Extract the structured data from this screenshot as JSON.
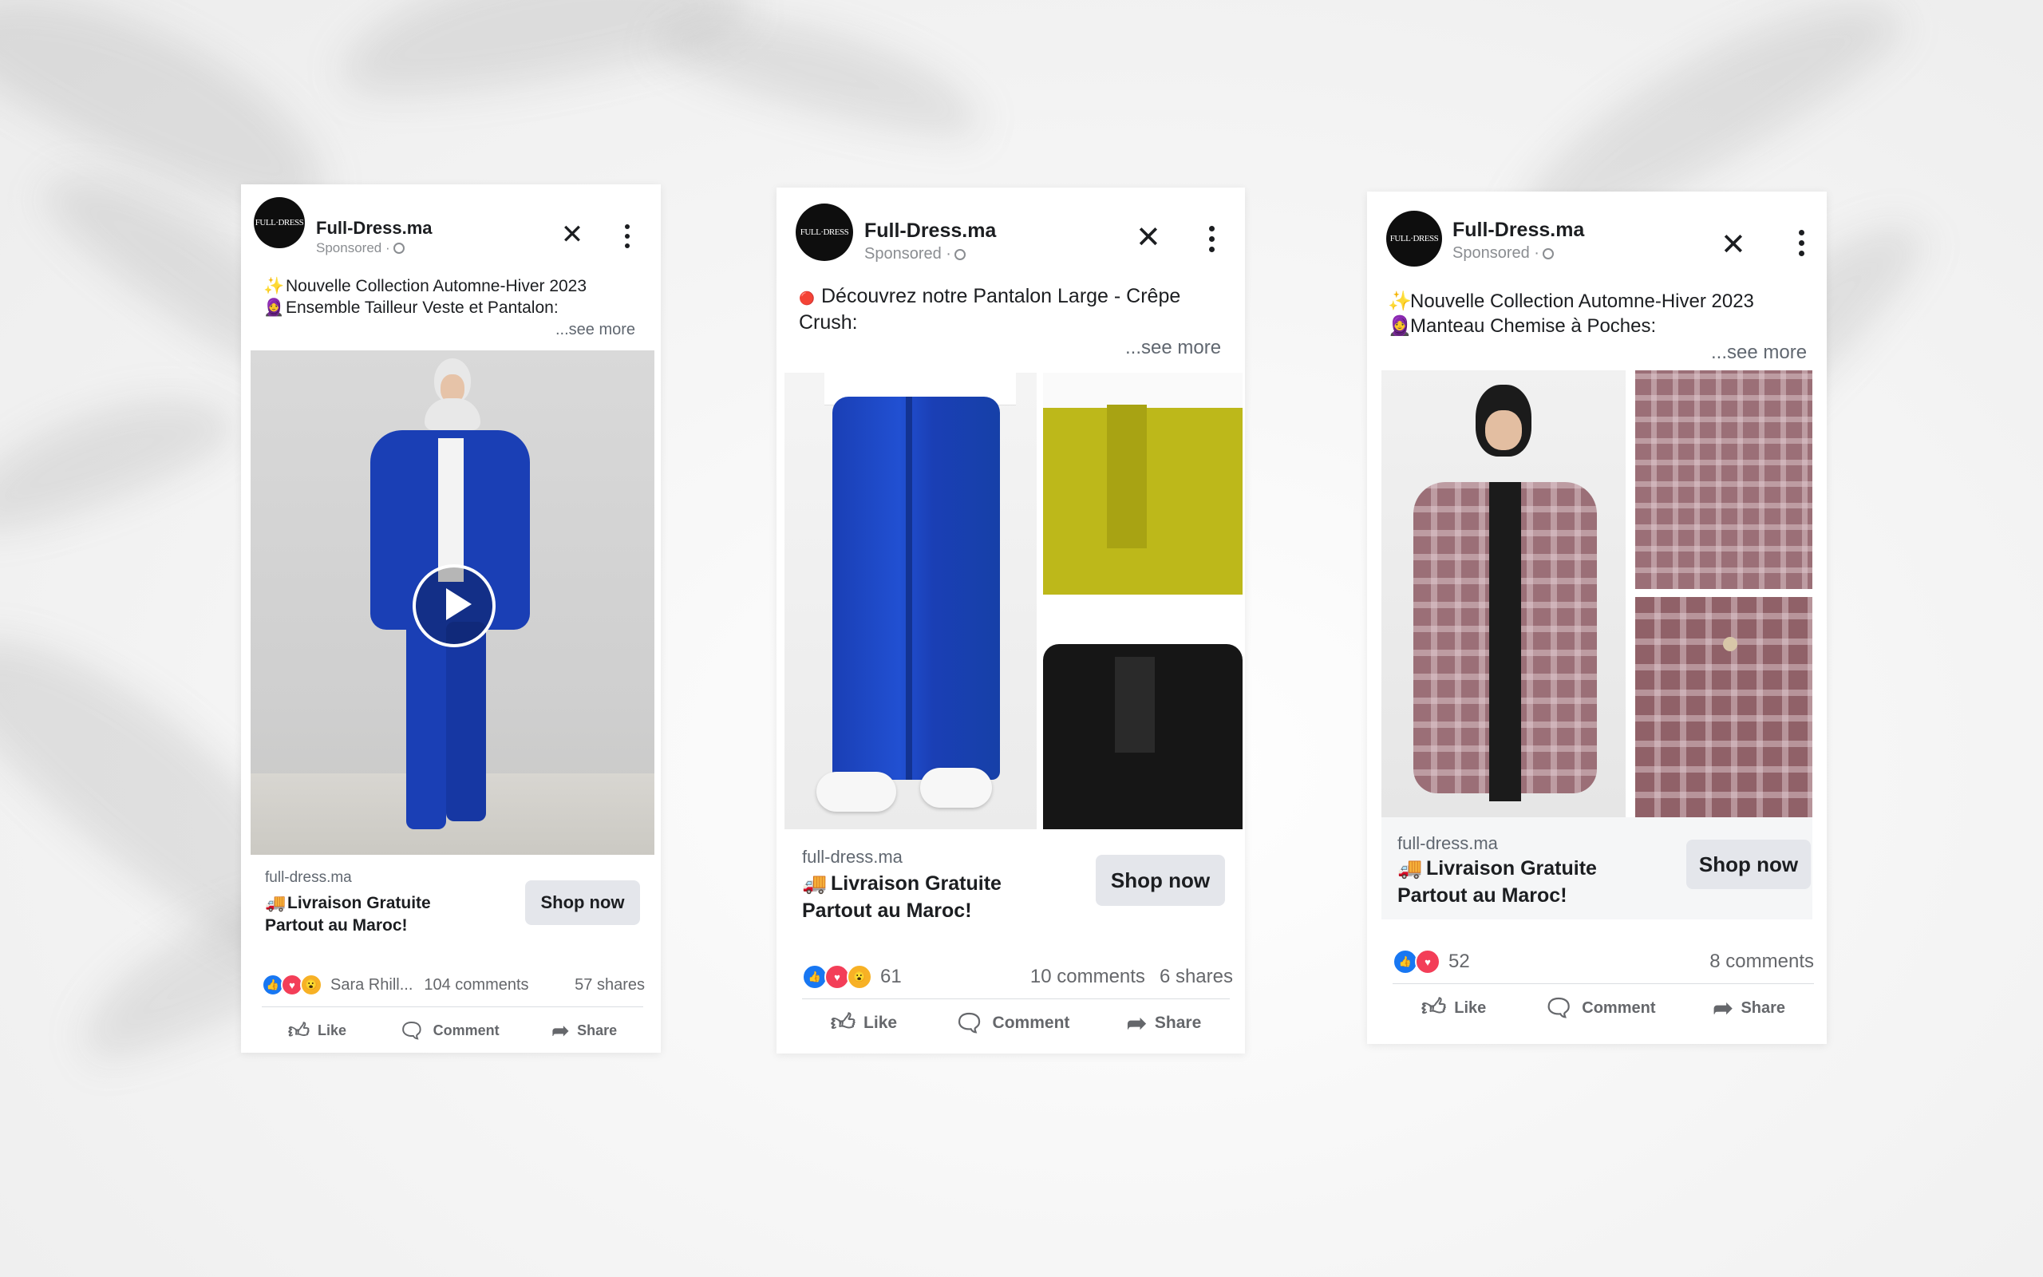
{
  "ads": [
    {
      "page_name": "Full-Dress.ma",
      "sponsored": "Sponsored ·",
      "avatar_text": "FULL·DRESS",
      "caption_line1": "Nouvelle Collection Automne-Hiver 2023",
      "caption_line2": "Ensemble Tailleur Veste et Pantalon:",
      "emoji1": "✨",
      "emoji2": "🧕",
      "see_more": "...see more",
      "domain": "full-dress.ma",
      "headline_line1": "Livraison Gratuite",
      "headline_line2": "Partout au Maroc!",
      "headline_emoji": "🚚",
      "cta": "Shop now",
      "reactions_text": "Sara Rhill...",
      "comments": "104 comments",
      "shares": "57 shares",
      "like": "Like",
      "comment": "Comment",
      "share": "Share"
    },
    {
      "page_name": "Full-Dress.ma",
      "sponsored": "Sponsored ·",
      "avatar_text": "FULL·DRESS",
      "caption_line1": "Découvrez notre Pantalon Large - Crêpe",
      "caption_line2": "Crush:",
      "emoji1": "🔴",
      "see_more": "...see more",
      "domain": "full-dress.ma",
      "headline_line1": "Livraison Gratuite",
      "headline_line2": "Partout au Maroc!",
      "headline_emoji": "🚚",
      "cta": "Shop now",
      "reactions_text": "61",
      "comments": "10 comments",
      "shares": "6 shares",
      "like": "Like",
      "comment": "Comment",
      "share": "Share"
    },
    {
      "page_name": "Full-Dress.ma",
      "sponsored": "Sponsored ·",
      "avatar_text": "FULL·DRESS",
      "caption_line1": "Nouvelle Collection Automne-Hiver 2023",
      "caption_line2": "Manteau Chemise à Poches:",
      "emoji1": "✨",
      "emoji2": "🧕",
      "see_more": "...see more",
      "domain": "full-dress.ma",
      "headline_line1": "Livraison Gratuite",
      "headline_line2": "Partout au Maroc!",
      "headline_emoji": "🚚",
      "cta": "Shop now",
      "reactions_text": "52",
      "comments": "8 comments",
      "like": "Like",
      "comment": "Comment",
      "share": "Share"
    }
  ],
  "colors": {
    "like_blue": "#1877f2",
    "love_red": "#f33e58",
    "wow_yellow": "#f7b125",
    "cta_bg": "#e4e6eb",
    "cobalt_suit": "#1a3fb5",
    "pant_yellow": "#bdb81a",
    "plaid_mauve": "#9b6f77"
  }
}
